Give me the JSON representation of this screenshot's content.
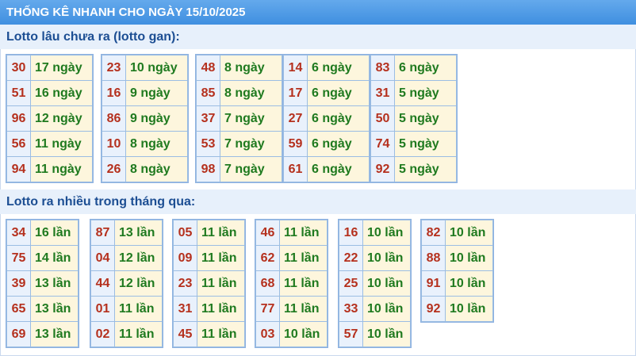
{
  "header": {
    "title": "THỐNG KÊ NHANH CHO NGÀY 15/10/2025"
  },
  "section_gan": {
    "heading": "Lotto lâu chưa ra (lotto gan):",
    "groups": [
      [
        {
          "n": "30",
          "v": "17 ngày"
        },
        {
          "n": "51",
          "v": "16 ngày"
        },
        {
          "n": "96",
          "v": "12 ngày"
        },
        {
          "n": "56",
          "v": "11 ngày"
        },
        {
          "n": "94",
          "v": "11 ngày"
        }
      ],
      [
        {
          "n": "23",
          "v": "10 ngày"
        },
        {
          "n": "16",
          "v": "9 ngày"
        },
        {
          "n": "86",
          "v": "9 ngày"
        },
        {
          "n": "10",
          "v": "8 ngày"
        },
        {
          "n": "26",
          "v": "8 ngày"
        }
      ],
      [
        {
          "n": "48",
          "v": "8 ngày"
        },
        {
          "n": "85",
          "v": "8 ngày"
        },
        {
          "n": "37",
          "v": "7 ngày"
        },
        {
          "n": "53",
          "v": "7 ngày"
        },
        {
          "n": "98",
          "v": "7 ngày"
        }
      ],
      [
        {
          "n": "14",
          "v": "6 ngày"
        },
        {
          "n": "17",
          "v": "6 ngày"
        },
        {
          "n": "27",
          "v": "6 ngày"
        },
        {
          "n": "59",
          "v": "6 ngày"
        },
        {
          "n": "61",
          "v": "6 ngày"
        }
      ],
      [
        {
          "n": "83",
          "v": "6 ngày"
        },
        {
          "n": "31",
          "v": "5 ngày"
        },
        {
          "n": "50",
          "v": "5 ngày"
        },
        {
          "n": "74",
          "v": "5 ngày"
        },
        {
          "n": "92",
          "v": "5 ngày"
        }
      ]
    ]
  },
  "section_nhieu": {
    "heading": "Lotto ra nhiều trong tháng qua:",
    "groups": [
      [
        {
          "n": "34",
          "v": "16 lần"
        },
        {
          "n": "75",
          "v": "14 lần"
        },
        {
          "n": "39",
          "v": "13 lần"
        },
        {
          "n": "65",
          "v": "13 lần"
        },
        {
          "n": "69",
          "v": "13 lần"
        }
      ],
      [
        {
          "n": "87",
          "v": "13 lần"
        },
        {
          "n": "04",
          "v": "12 lần"
        },
        {
          "n": "44",
          "v": "12 lần"
        },
        {
          "n": "01",
          "v": "11 lần"
        },
        {
          "n": "02",
          "v": "11 lần"
        }
      ],
      [
        {
          "n": "05",
          "v": "11 lần"
        },
        {
          "n": "09",
          "v": "11 lần"
        },
        {
          "n": "23",
          "v": "11 lần"
        },
        {
          "n": "31",
          "v": "11 lần"
        },
        {
          "n": "45",
          "v": "11 lần"
        }
      ],
      [
        {
          "n": "46",
          "v": "11 lần"
        },
        {
          "n": "62",
          "v": "11 lần"
        },
        {
          "n": "68",
          "v": "11 lần"
        },
        {
          "n": "77",
          "v": "11 lần"
        },
        {
          "n": "03",
          "v": "10 lần"
        }
      ],
      [
        {
          "n": "16",
          "v": "10 lần"
        },
        {
          "n": "22",
          "v": "10 lần"
        },
        {
          "n": "25",
          "v": "10 lần"
        },
        {
          "n": "33",
          "v": "10 lần"
        },
        {
          "n": "57",
          "v": "10 lần"
        }
      ],
      [
        {
          "n": "82",
          "v": "10 lần"
        },
        {
          "n": "88",
          "v": "10 lần"
        },
        {
          "n": "91",
          "v": "10 lần"
        },
        {
          "n": "92",
          "v": "10 lần"
        }
      ]
    ]
  }
}
